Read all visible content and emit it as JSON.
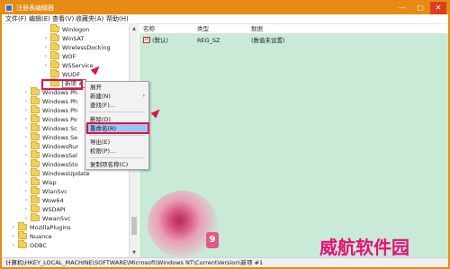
{
  "window": {
    "title": "注册表编辑器",
    "accent": "#e78c13"
  },
  "title_buttons": {
    "minimize": "—",
    "maximize": "□",
    "close": "✕"
  },
  "menu": [
    "文件(F)",
    "编辑(E)",
    "查看(V)",
    "收藏夹(A)",
    "帮助(H)"
  ],
  "tree": {
    "items": [
      {
        "label": "Winlogon",
        "expandable": false
      },
      {
        "label": "WinSAT",
        "expandable": true
      },
      {
        "label": "WirelessDocking",
        "expandable": true
      },
      {
        "label": "WOF",
        "expandable": true
      },
      {
        "label": "WSService",
        "expandable": true
      },
      {
        "label": "WUDF",
        "expandable": false
      },
      {
        "label": "新项 #",
        "expandable": false,
        "selected": true
      },
      {
        "label": "Windows Ph",
        "expandable": true
      },
      {
        "label": "Windows Ph",
        "expandable": true
      },
      {
        "label": "Windows Ph",
        "expandable": true
      },
      {
        "label": "Windows Po",
        "expandable": true
      },
      {
        "label": "Windows Sc",
        "expandable": true
      },
      {
        "label": "Windows Se",
        "expandable": true
      },
      {
        "label": "WindowsRur",
        "expandable": true
      },
      {
        "label": "WindowsSel",
        "expandable": true
      },
      {
        "label": "WindowsSto",
        "expandable": true
      },
      {
        "label": "WindowsUpdate",
        "expandable": true
      },
      {
        "label": "Wisp",
        "expandable": true
      },
      {
        "label": "WlanSvc",
        "expandable": true
      },
      {
        "label": "Wow64",
        "expandable": true
      },
      {
        "label": "WSDAPI",
        "expandable": true
      },
      {
        "label": "WwanSvc",
        "expandable": true
      },
      {
        "label": "MozillaPlugins",
        "expandable": true
      },
      {
        "label": "Nuance",
        "expandable": true
      },
      {
        "label": "ODBC",
        "expandable": true
      }
    ]
  },
  "list": {
    "headers": [
      "名称",
      "类型",
      "数据"
    ],
    "rows": [
      {
        "icon": "ab",
        "name": "(默认)",
        "type": "REG_SZ",
        "data": "(数值未设置)"
      }
    ]
  },
  "context_menu": {
    "items": [
      {
        "label": "展开",
        "submenu": false
      },
      {
        "label": "新建(N)",
        "submenu": true
      },
      {
        "label": "查找(F)...",
        "submenu": false
      },
      {
        "label": "删除(D)",
        "submenu": false
      },
      {
        "label": "重命名(R)",
        "submenu": false,
        "highlighted": true
      },
      {
        "label": "导出(E)",
        "submenu": false
      },
      {
        "label": "权限(P)...",
        "submenu": false
      },
      {
        "label": "复制项名称(C)",
        "submenu": false
      }
    ]
  },
  "overlay": {
    "badge": "9"
  },
  "status_bar": {
    "path": "计算机\\HKEY_LOCAL_MACHINE\\SOFTWARE\\Microsoft\\Windows NT\\CurrentVersion\\新项 #1"
  },
  "watermark": "威航软件园",
  "colors": {
    "highlight": "#e0104a",
    "list_bg": "#c8ead7",
    "selection": "#9dc4f0"
  }
}
